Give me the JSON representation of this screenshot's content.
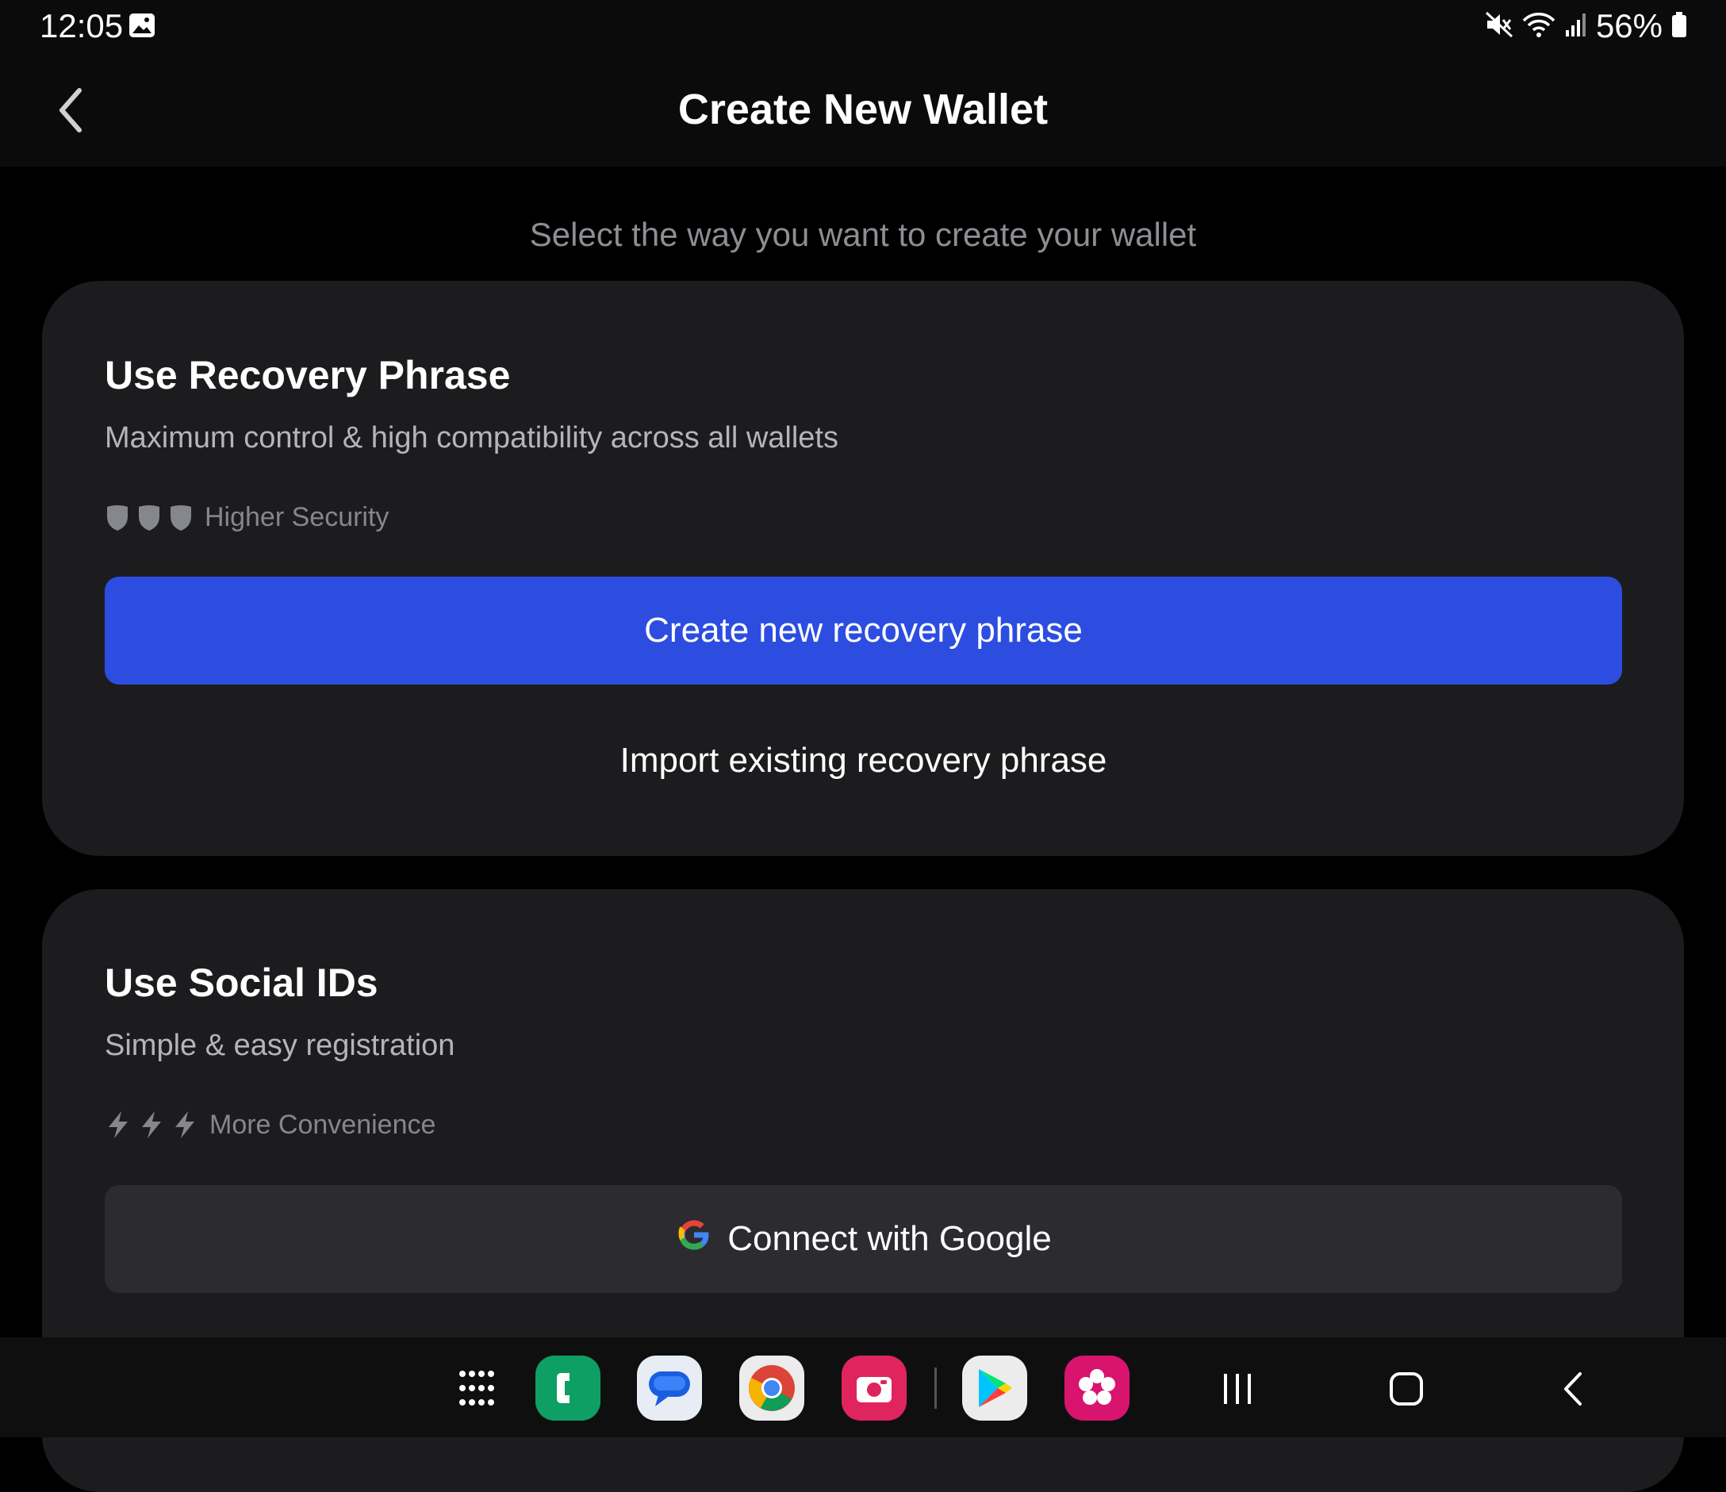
{
  "status_bar": {
    "time": "12:05",
    "battery_percent": "56%",
    "icons": [
      "gallery-icon",
      "mute-icon",
      "wifi-icon",
      "signal-icon",
      "battery-icon"
    ]
  },
  "header": {
    "title": "Create New Wallet",
    "back_icon": "chevron-left-icon"
  },
  "subtitle": "Select the way you want to create your wallet",
  "recovery_card": {
    "title": "Use Recovery Phrase",
    "description": "Maximum control & high compatibility across all wallets",
    "rating_icon": "shield-icon",
    "rating_label": "Higher Security",
    "primary_button": "Create new recovery phrase",
    "secondary_button": "Import existing recovery phrase"
  },
  "social_card": {
    "title": "Use Social IDs",
    "description": "Simple & easy registration",
    "rating_icon": "lightning-icon",
    "rating_label": "More Convenience",
    "google_button": "Connect with Google"
  },
  "nav_bar": {
    "dock_apps": [
      "app-drawer-icon",
      "phone-app-icon",
      "messages-app-icon",
      "chrome-app-icon",
      "camera-app-icon",
      "play-store-app-icon",
      "blossom-app-icon"
    ],
    "buttons": [
      "recents-button",
      "home-button",
      "back-button"
    ]
  },
  "colors": {
    "accent": "#2d4de0",
    "card_bg": "#1c1c1e",
    "background": "#000000",
    "secondary_text": "#b4b5ba",
    "muted_text": "#86878c"
  }
}
